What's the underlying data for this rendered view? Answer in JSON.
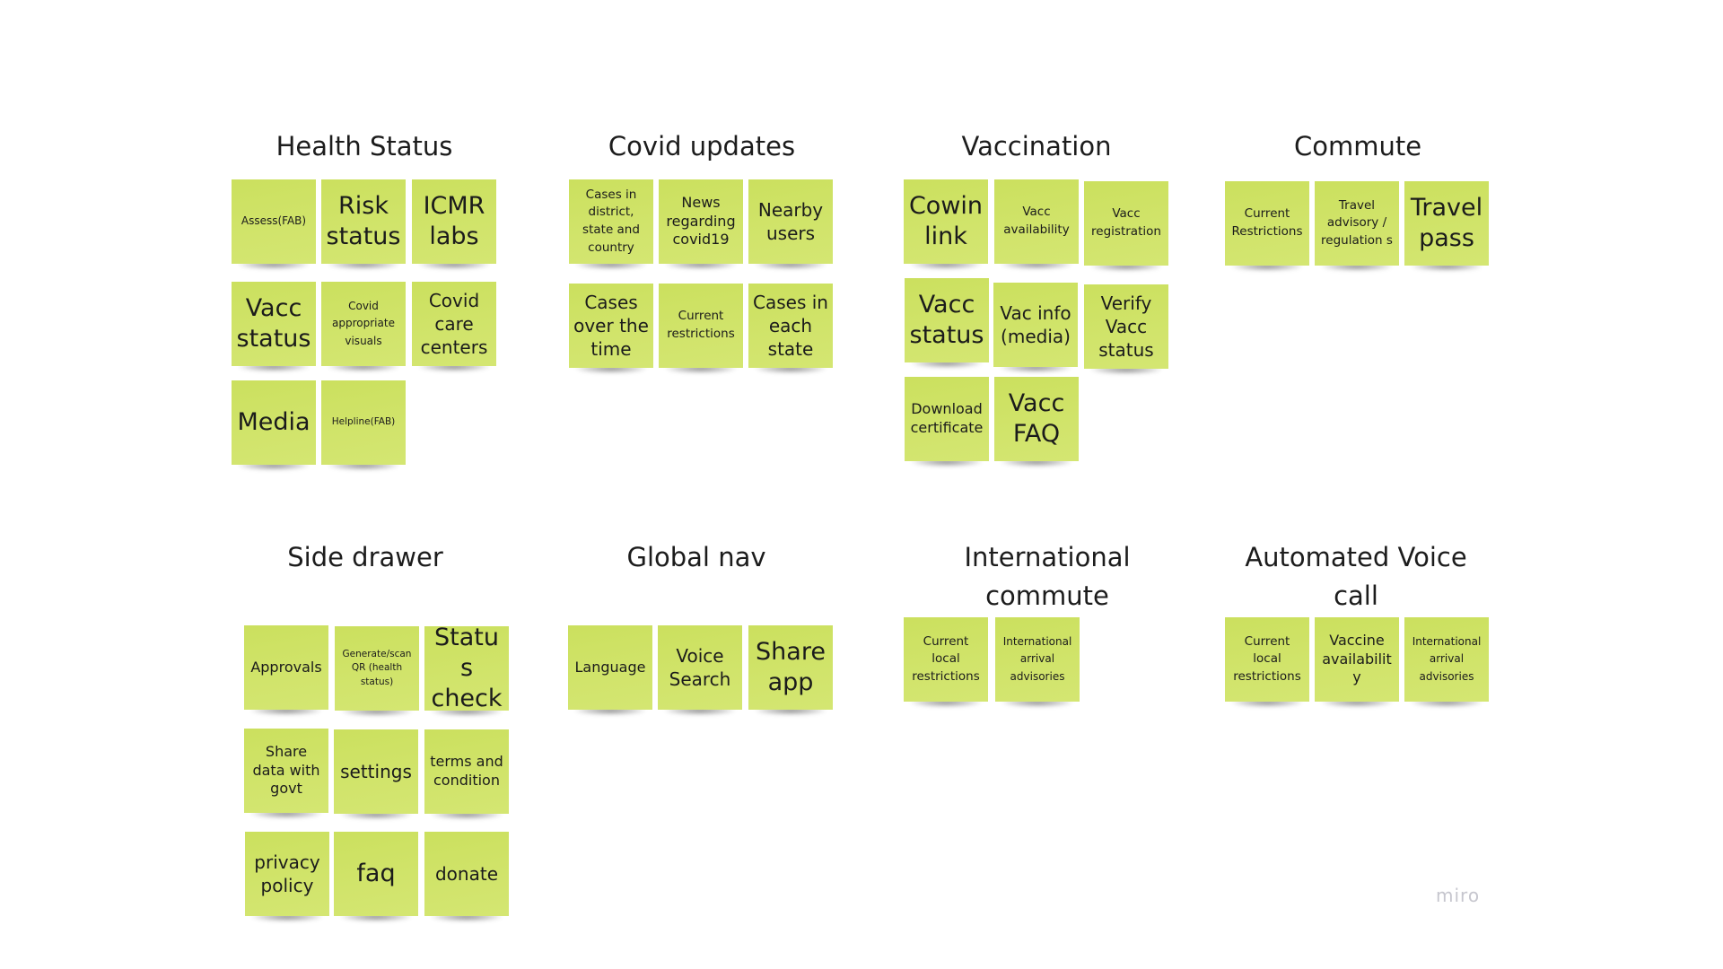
{
  "board": {
    "watermark": "miro",
    "note_color": "#d0e36a",
    "groups": {
      "health_status": {
        "title": "Health Status",
        "notes": [
          "Assess(FAB)",
          "Risk status",
          "ICMR labs",
          "Vacc status",
          "Covid appropriate visuals",
          "Covid care centers",
          "Media",
          "Helpline(FAB)"
        ]
      },
      "covid_updates": {
        "title": "Covid updates",
        "notes": [
          "Cases in district, state and country",
          "News regarding covid19",
          "Nearby users",
          "Cases over the time",
          "Current restrictions",
          "Cases in each state"
        ]
      },
      "vaccination": {
        "title": "Vaccination",
        "notes": [
          "Cowin link",
          "Vacc availability",
          "Vacc registration",
          "Vacc status",
          "Vac info (media)",
          "Verify Vacc status",
          "Download certificate",
          "Vacc FAQ"
        ]
      },
      "commute": {
        "title": "Commute",
        "notes": [
          "Current Restrictions",
          "Travel advisory / regulation s",
          "Travel pass"
        ]
      },
      "side_drawer": {
        "title": "Side drawer",
        "notes": [
          "Approvals",
          "Generate/scan QR (health status)",
          "Status check",
          "Share data with govt",
          "settings",
          "terms and condition",
          "privacy policy",
          "faq",
          "donate"
        ]
      },
      "global_nav": {
        "title": "Global nav",
        "notes": [
          "Language",
          "Voice Search",
          "Share app"
        ]
      },
      "international_commute": {
        "title": "International\ncommute",
        "notes": [
          "Current local restrictions",
          "International arrival advisories"
        ]
      },
      "automated_voice_call": {
        "title": "Automated Voice call",
        "notes": [
          "Current local restrictions",
          "Vaccine availability",
          "International arrival advisories"
        ]
      }
    }
  }
}
